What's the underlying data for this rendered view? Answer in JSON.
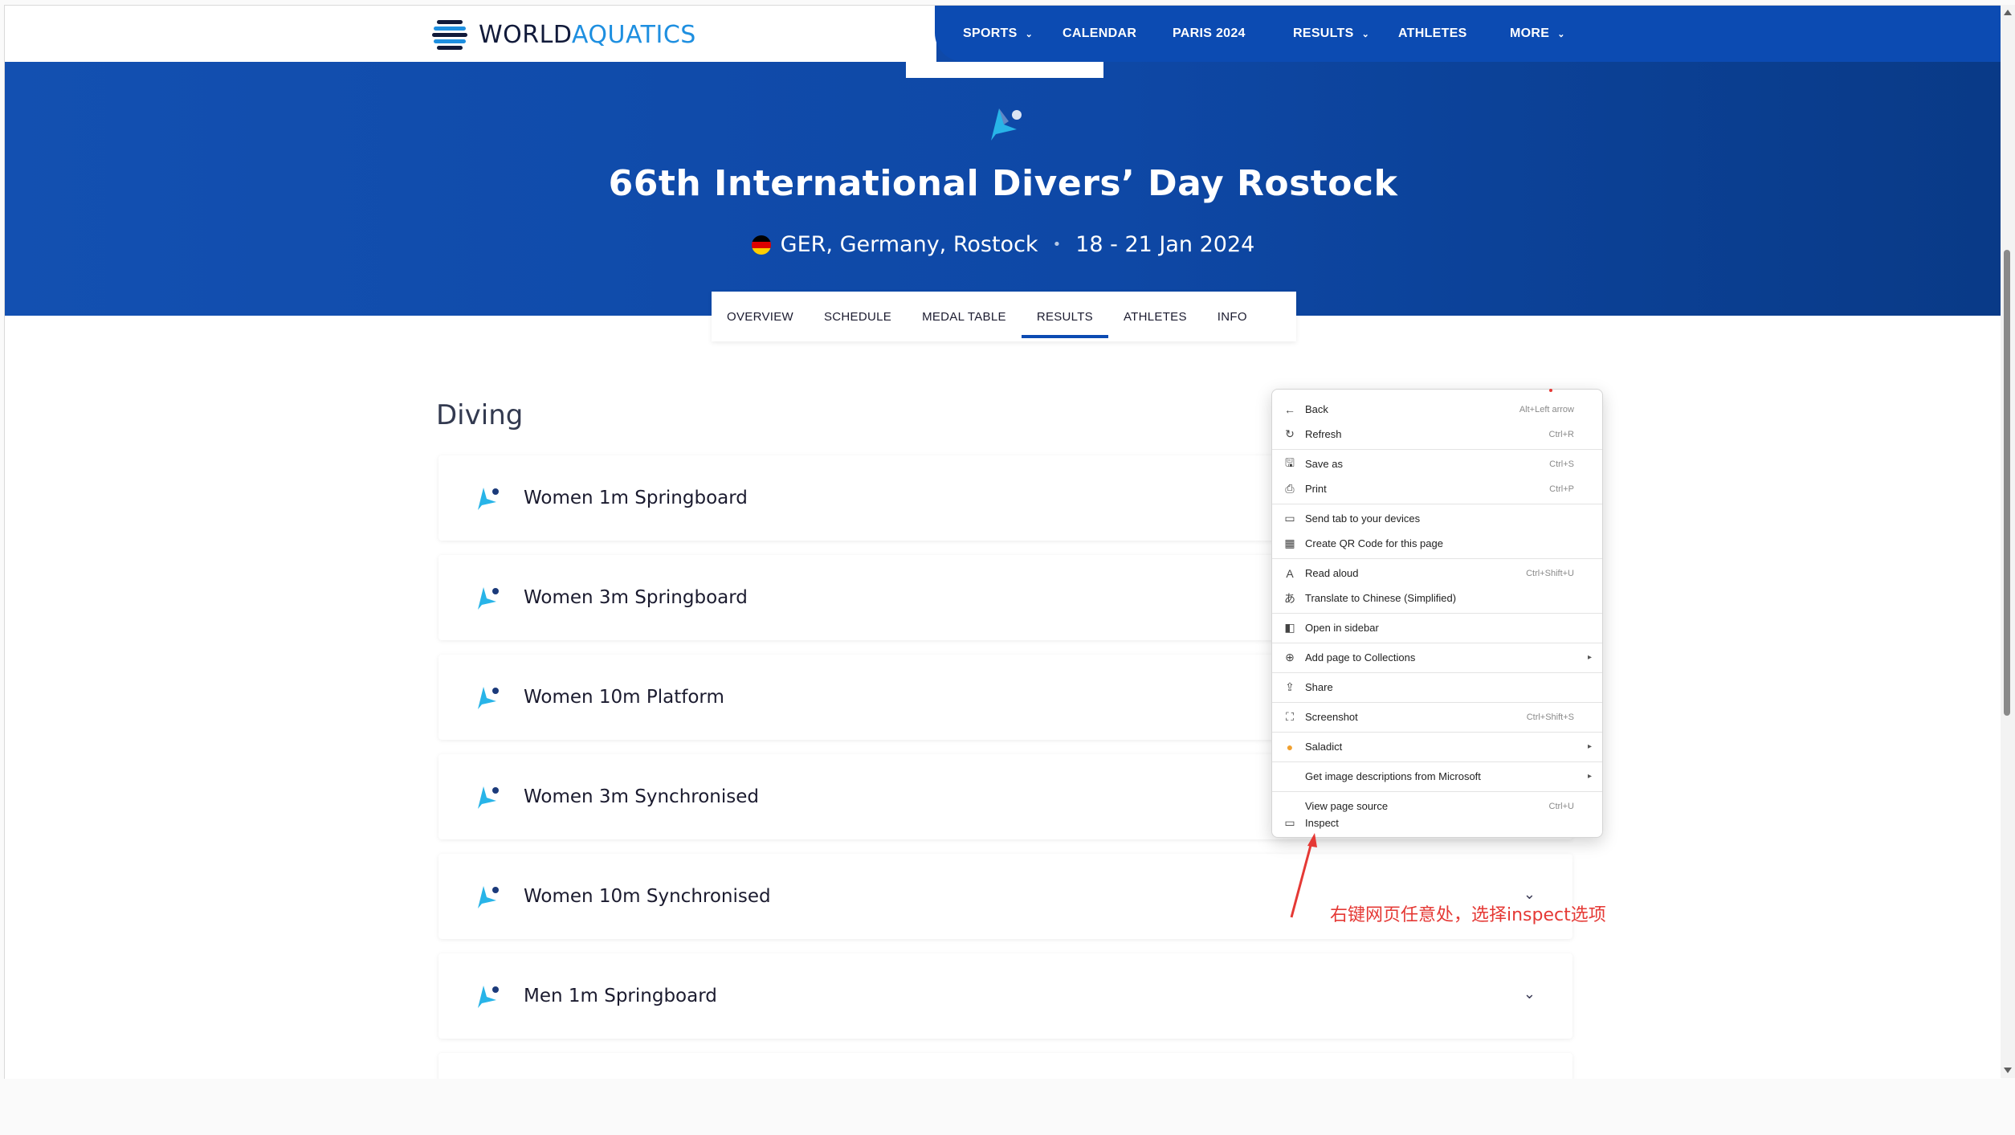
{
  "header": {
    "logo_world": "WORLD",
    "logo_aquatics": "AQUATICS",
    "nav": [
      {
        "label": "SPORTS",
        "has_dropdown": true
      },
      {
        "label": "CALENDAR",
        "has_dropdown": false
      },
      {
        "label": "PARIS 2024",
        "has_dropdown": false
      },
      {
        "label": "RESULTS",
        "has_dropdown": true
      },
      {
        "label": "ATHLETES",
        "has_dropdown": false
      },
      {
        "label": "MORE",
        "has_dropdown": true
      }
    ],
    "chevron": "⌄"
  },
  "event": {
    "title": "66th International Divers’ Day Rostock",
    "location": "GER, Germany, Rostock",
    "dot": "•",
    "dates": "18 - 21 Jan 2024"
  },
  "subtabs": [
    {
      "label": "OVERVIEW",
      "active": false
    },
    {
      "label": "SCHEDULE",
      "active": false
    },
    {
      "label": "MEDAL TABLE",
      "active": false
    },
    {
      "label": "RESULTS",
      "active": true
    },
    {
      "label": "ATHLETES",
      "active": false
    },
    {
      "label": "INFO",
      "active": false
    }
  ],
  "results": {
    "section_title": "Diving",
    "events": [
      {
        "label": "Women 1m Springboard"
      },
      {
        "label": "Women 3m Springboard"
      },
      {
        "label": "Women 10m Platform"
      },
      {
        "label": "Women 3m Synchronised"
      },
      {
        "label": "Women 10m Synchronised"
      },
      {
        "label": "Men 1m Springboard"
      }
    ],
    "expand_chevron": "⌄"
  },
  "context_menu": {
    "items": [
      {
        "icon": "back-arrow-icon",
        "glyph": "←",
        "label": "Back",
        "shortcut": "Alt+Left arrow"
      },
      {
        "icon": "refresh-icon",
        "glyph": "↻",
        "label": "Refresh",
        "shortcut": "Ctrl+R"
      },
      {
        "icon": "save-icon",
        "glyph": "🖫",
        "label": "Save as",
        "shortcut": "Ctrl+S"
      },
      {
        "icon": "print-icon",
        "glyph": "⎙",
        "label": "Print",
        "shortcut": "Ctrl+P"
      },
      {
        "icon": "send-tab-icon",
        "glyph": "▭",
        "label": "Send tab to your devices",
        "shortcut": ""
      },
      {
        "icon": "qr-code-icon",
        "glyph": "▦",
        "label": "Create QR Code for this page",
        "shortcut": ""
      },
      {
        "icon": "read-aloud-icon",
        "glyph": "A",
        "label": "Read aloud",
        "shortcut": "Ctrl+Shift+U"
      },
      {
        "icon": "translate-icon",
        "glyph": "あ",
        "label": "Translate to Chinese (Simplified)",
        "shortcut": ""
      },
      {
        "icon": "sidebar-icon",
        "glyph": "◧",
        "label": "Open in sidebar",
        "shortcut": ""
      },
      {
        "icon": "collections-icon",
        "glyph": "⊕",
        "label": "Add page to Collections",
        "shortcut": "",
        "submenu": true
      },
      {
        "icon": "share-icon",
        "glyph": "⇪",
        "label": "Share",
        "shortcut": ""
      },
      {
        "icon": "screenshot-icon",
        "glyph": "⛶",
        "label": "Screenshot",
        "shortcut": "Ctrl+Shift+S"
      },
      {
        "icon": "saladict-icon",
        "glyph": "●",
        "label": "Saladict",
        "shortcut": "",
        "submenu": true
      },
      {
        "icon": "",
        "glyph": "",
        "label": "Get image descriptions from Microsoft",
        "shortcut": "",
        "submenu": true
      },
      {
        "icon": "",
        "glyph": "",
        "label": "View page source",
        "shortcut": "Ctrl+U"
      },
      {
        "icon": "inspect-icon",
        "glyph": "▭",
        "label": "Inspect",
        "shortcut": ""
      }
    ],
    "submenu_arrow": "▸"
  },
  "annotation": {
    "text": "右键网页任意处，选择inspect选项",
    "color": "#e53935"
  },
  "colors": {
    "brand_blue": "#0c4bb2",
    "accent_cyan": "#1e8fe0",
    "hero_gradient_start": "#1350b1",
    "hero_gradient_end": "#093a87"
  }
}
